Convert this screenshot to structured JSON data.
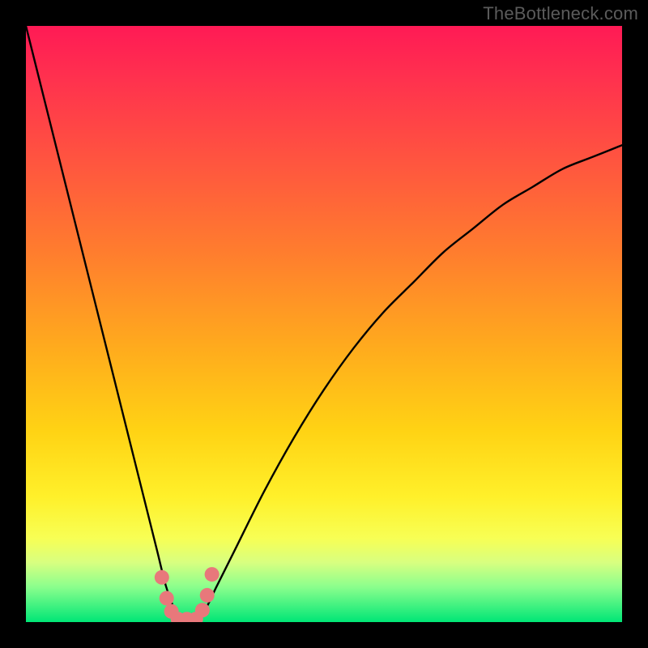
{
  "watermark": {
    "text": "TheBottleneck.com"
  },
  "chart_data": {
    "type": "line",
    "title": "",
    "xlabel": "",
    "ylabel": "",
    "xlim": [
      0,
      100
    ],
    "ylim": [
      0,
      100
    ],
    "series": [
      {
        "name": "bottleneck-curve",
        "x": [
          0,
          5,
          10,
          15,
          18,
          20,
          22,
          23.5,
          25,
          26.5,
          28,
          30,
          32,
          35,
          40,
          45,
          50,
          55,
          60,
          65,
          70,
          75,
          80,
          85,
          90,
          95,
          100
        ],
        "y": [
          100,
          80,
          60,
          40,
          28,
          20,
          12,
          6,
          2,
          0,
          0,
          2,
          6,
          12,
          22,
          31,
          39,
          46,
          52,
          57,
          62,
          66,
          70,
          73,
          76,
          78,
          80
        ]
      }
    ],
    "markers": {
      "name": "highlight-dots",
      "x": [
        22.8,
        23.6,
        24.4,
        25.5,
        27.0,
        28.5,
        29.6,
        30.4,
        31.2
      ],
      "y": [
        7.5,
        4.0,
        1.8,
        0.5,
        0.5,
        0.5,
        2.0,
        4.5,
        8.0
      ]
    },
    "gradient_stops": [
      {
        "pos": 0.0,
        "color": "#ff1a55"
      },
      {
        "pos": 0.08,
        "color": "#ff2f4f"
      },
      {
        "pos": 0.22,
        "color": "#ff5340"
      },
      {
        "pos": 0.38,
        "color": "#ff7d2e"
      },
      {
        "pos": 0.54,
        "color": "#ffab1d"
      },
      {
        "pos": 0.68,
        "color": "#ffd314"
      },
      {
        "pos": 0.79,
        "color": "#fff02a"
      },
      {
        "pos": 0.86,
        "color": "#f7ff55"
      },
      {
        "pos": 0.9,
        "color": "#d8ff80"
      },
      {
        "pos": 0.94,
        "color": "#8dff8d"
      },
      {
        "pos": 1.0,
        "color": "#00e676"
      }
    ],
    "marker_color": "#e8787b",
    "curve_color": "#000000"
  }
}
